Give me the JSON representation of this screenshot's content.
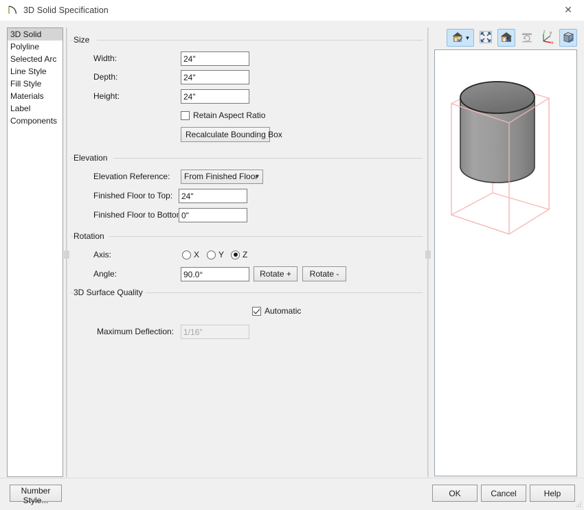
{
  "window": {
    "title": "3D Solid Specification",
    "icon": "arc-curve-icon",
    "close_label": "✕"
  },
  "sidebar": {
    "items": [
      {
        "label": "3D Solid",
        "selected": true
      },
      {
        "label": "Polyline",
        "selected": false
      },
      {
        "label": "Selected Arc",
        "selected": false
      },
      {
        "label": "Line Style",
        "selected": false
      },
      {
        "label": "Fill Style",
        "selected": false
      },
      {
        "label": "Materials",
        "selected": false
      },
      {
        "label": "Label",
        "selected": false
      },
      {
        "label": "Components",
        "selected": false
      }
    ]
  },
  "size": {
    "group_title": "Size",
    "width_label": "Width:",
    "width_value": "24\"",
    "depth_label": "Depth:",
    "depth_value": "24\"",
    "height_label": "Height:",
    "height_value": "24\"",
    "retain_aspect_label": "Retain Aspect Ratio",
    "retain_aspect_checked": false,
    "recalculate_label": "Recalculate Bounding Box"
  },
  "elevation": {
    "group_title": "Elevation",
    "reference_label": "Elevation Reference:",
    "reference_value": "From Finished Floor",
    "reference_options": [
      "From Finished Floor"
    ],
    "floor_to_top_label": "Finished Floor to Top:",
    "floor_to_top_value": "24\"",
    "floor_to_bottom_label": "Finished Floor to Bottom:",
    "floor_to_bottom_value": "0\""
  },
  "rotation": {
    "group_title": "Rotation",
    "axis_label": "Axis:",
    "axis_options": [
      {
        "label": "X",
        "selected": false
      },
      {
        "label": "Y",
        "selected": false
      },
      {
        "label": "Z",
        "selected": true
      }
    ],
    "angle_label": "Angle:",
    "angle_value": "90.0°",
    "rotate_plus_label": "Rotate +",
    "rotate_minus_label": "Rotate -"
  },
  "surface_quality": {
    "group_title": "3D Surface Quality",
    "automatic_label": "Automatic",
    "automatic_checked": true,
    "max_deflection_label": "Maximum Deflection:",
    "max_deflection_value": "1/16\"",
    "max_deflection_enabled": false
  },
  "preview_toolbar": {
    "buttons": [
      {
        "name": "view-mode-button",
        "icon": "house-check-icon",
        "active": true,
        "has_dropdown": true
      },
      {
        "name": "fill-window-button",
        "icon": "expand-arrows-icon",
        "active": false,
        "has_dropdown": false
      },
      {
        "name": "glass-house-button",
        "icon": "house-door-check-icon",
        "active": true,
        "has_dropdown": false
      },
      {
        "name": "refresh-preview-button",
        "icon": "refresh-bar-icon",
        "active": false,
        "disabled": true,
        "has_dropdown": false
      },
      {
        "name": "axis-indicator-button",
        "icon": "zyx-axis-icon",
        "active": false,
        "has_dropdown": false
      },
      {
        "name": "show-bounding-box-button",
        "icon": "box-check-icon",
        "active": true,
        "has_dropdown": false
      }
    ]
  },
  "preview": {
    "object": "cylinder",
    "object_color": "#8c8c8c",
    "bounding_box_color": "#f7b9b9",
    "background": "#ffffff"
  },
  "footer": {
    "number_style_label": "Number Style...",
    "ok_label": "OK",
    "cancel_label": "Cancel",
    "help_label": "Help"
  }
}
